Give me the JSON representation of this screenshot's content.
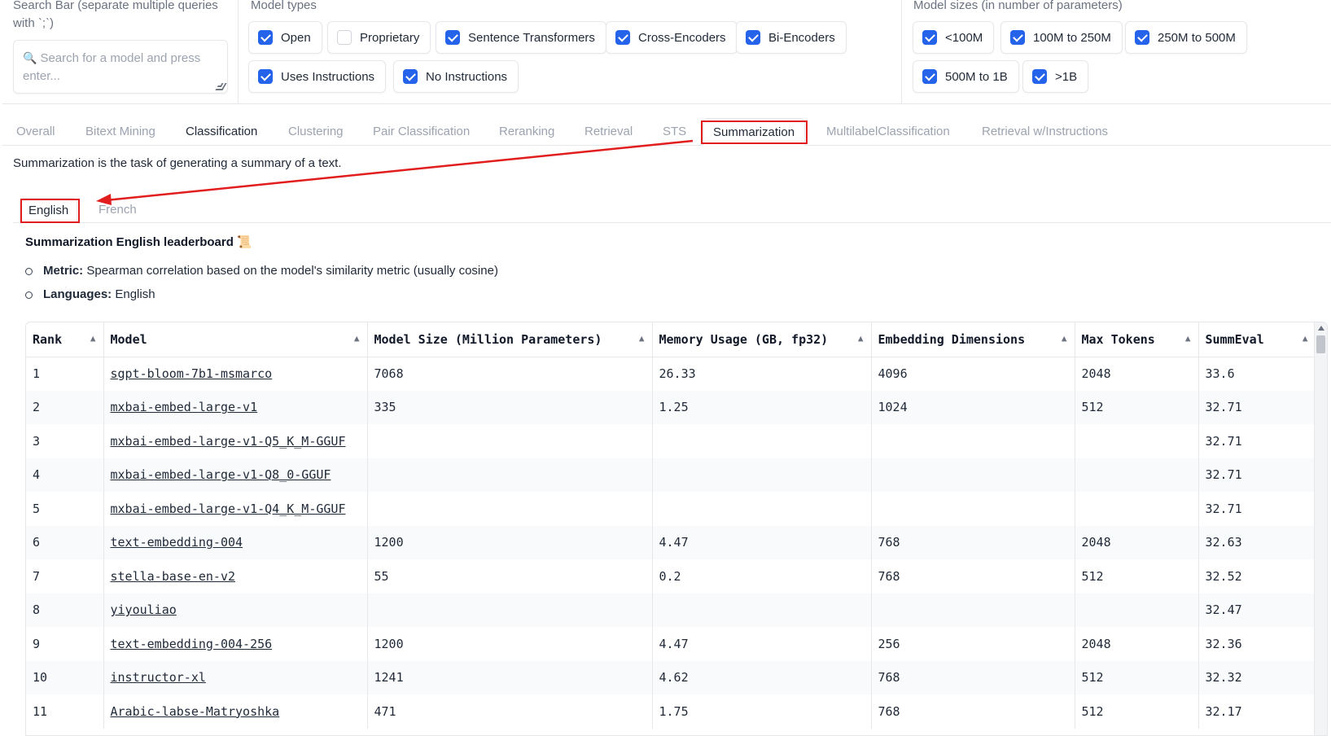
{
  "filters": {
    "search": {
      "label": "Search Bar (separate multiple queries with `;`)",
      "placeholder": "Search for a model and press enter..."
    },
    "model_types": {
      "label": "Model types",
      "options": [
        {
          "label": "Open",
          "checked": true
        },
        {
          "label": "Proprietary",
          "checked": false
        },
        {
          "label": "Sentence Transformers",
          "checked": true
        },
        {
          "label": "Cross-Encoders",
          "checked": true
        },
        {
          "label": "Bi-Encoders",
          "checked": true
        },
        {
          "label": "Uses Instructions",
          "checked": true
        },
        {
          "label": "No Instructions",
          "checked": true
        }
      ]
    },
    "model_sizes": {
      "label": "Model sizes (in number of parameters)",
      "options": [
        {
          "label": "<100M",
          "checked": true
        },
        {
          "label": "100M to 250M",
          "checked": true
        },
        {
          "label": "250M to 500M",
          "checked": true
        },
        {
          "label": "500M to 1B",
          "checked": true
        },
        {
          "label": ">1B",
          "checked": true
        }
      ]
    }
  },
  "tabs": [
    "Overall",
    "Bitext Mining",
    "Classification",
    "Clustering",
    "Pair Classification",
    "Reranking",
    "Retrieval",
    "STS",
    "Summarization",
    "MultilabelClassification",
    "Retrieval w/Instructions"
  ],
  "active_tab": "Summarization",
  "description": "Summarization is the task of generating a summary of a text.",
  "subtabs": [
    "English",
    "French"
  ],
  "active_subtab": "English",
  "leaderboard": {
    "title": "Summarization English leaderboard",
    "title_icon": "scroll-emoji",
    "metric_label": "Metric:",
    "metric_value": "Spearman correlation based on the model's similarity metric (usually cosine)",
    "languages_label": "Languages:",
    "languages_value": "English"
  },
  "table": {
    "columns": [
      "Rank",
      "Model",
      "Model Size (Million Parameters)",
      "Memory Usage (GB, fp32)",
      "Embedding Dimensions",
      "Max Tokens",
      "SummEval"
    ],
    "rows": [
      [
        "1",
        "sgpt-bloom-7b1-msmarco",
        "7068",
        "26.33",
        "4096",
        "2048",
        "33.6"
      ],
      [
        "2",
        "mxbai-embed-large-v1",
        "335",
        "1.25",
        "1024",
        "512",
        "32.71"
      ],
      [
        "3",
        "mxbai-embed-large-v1-Q5_K_M-GGUF",
        "",
        "",
        "",
        "",
        "32.71"
      ],
      [
        "4",
        "mxbai-embed-large-v1-Q8_0-GGUF",
        "",
        "",
        "",
        "",
        "32.71"
      ],
      [
        "5",
        "mxbai-embed-large-v1-Q4_K_M-GGUF",
        "",
        "",
        "",
        "",
        "32.71"
      ],
      [
        "6",
        "text-embedding-004",
        "1200",
        "4.47",
        "768",
        "2048",
        "32.63"
      ],
      [
        "7",
        "stella-base-en-v2",
        "55",
        "0.2",
        "768",
        "512",
        "32.52"
      ],
      [
        "8",
        "yiyouliao",
        "",
        "",
        "",
        "",
        "32.47"
      ],
      [
        "9",
        "text-embedding-004-256",
        "1200",
        "4.47",
        "256",
        "2048",
        "32.36"
      ],
      [
        "10",
        "instructor-xl",
        "1241",
        "4.62",
        "768",
        "512",
        "32.32"
      ],
      [
        "11",
        "Arabic-labse-Matryoshka",
        "471",
        "1.75",
        "768",
        "512",
        "32.17"
      ]
    ]
  },
  "colors": {
    "accent": "#2563eb",
    "highlight": "#e11d1d"
  }
}
